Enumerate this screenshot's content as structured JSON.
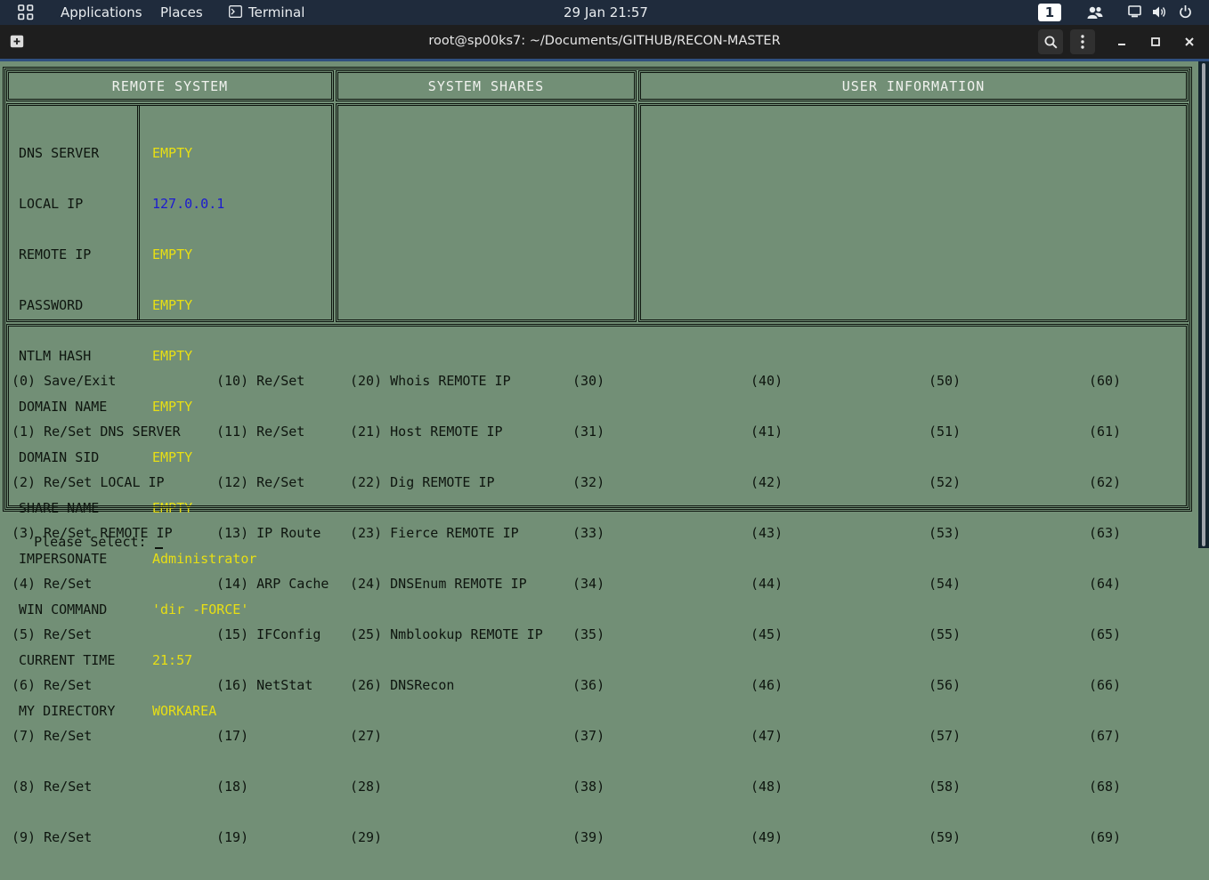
{
  "topbar": {
    "applications": "Applications",
    "places": "Places",
    "terminal": "Terminal",
    "clock": "29 Jan  21:57",
    "workspace": "1"
  },
  "window": {
    "title": "root@sp00ks7: ~/Documents/GITHUB/RECON-MASTER"
  },
  "panels": {
    "remote_system": "REMOTE SYSTEM",
    "system_shares": "SYSTEM SHARES",
    "user_information": "USER INFORMATION"
  },
  "fields": [
    {
      "label": "DNS SERVER",
      "value": "EMPTY"
    },
    {
      "label": "LOCAL IP",
      "value": "127.0.0.1"
    },
    {
      "label": "REMOTE IP",
      "value": "EMPTY"
    },
    {
      "label": "PASSWORD",
      "value": "EMPTY"
    },
    {
      "label": "NTLM HASH",
      "value": "EMPTY"
    },
    {
      "label": "DOMAIN NAME",
      "value": "EMPTY"
    },
    {
      "label": "DOMAIN SID",
      "value": "EMPTY"
    },
    {
      "label": "SHARE NAME",
      "value": "EMPTY"
    },
    {
      "label": "IMPERSONATE",
      "value": "Administrator"
    },
    {
      "label": "WIN COMMAND",
      "value": "'dir -FORCE'"
    },
    {
      "label": "CURRENT TIME",
      "value": "21:57"
    },
    {
      "label": "MY DIRECTORY",
      "value": "WORKAREA"
    }
  ],
  "colors": {
    "value_default": "#e8df14",
    "value_local_ip": "#1d1bd0",
    "background": "#728f76"
  },
  "menu": {
    "col0": [
      "(0) Save/Exit",
      "(1) Re/Set DNS SERVER",
      "(2) Re/Set LOCAL IP",
      "(3) Re/Set REMOTE IP",
      "(4) Re/Set",
      "(5) Re/Set",
      "(6) Re/Set",
      "(7) Re/Set",
      "(8) Re/Set",
      "(9) Re/Set"
    ],
    "col1": [
      "(10) Re/Set",
      "(11) Re/Set",
      "(12) Re/Set",
      "(13) IP Route",
      "(14) ARP Cache",
      "(15) IFConfig",
      "(16) NetStat",
      "(17)",
      "(18)",
      "(19)"
    ],
    "col2": [
      "(20) Whois REMOTE IP",
      "(21) Host REMOTE IP",
      "(22) Dig REMOTE IP",
      "(23) Fierce REMOTE IP",
      "(24) DNSEnum REMOTE IP",
      "(25) Nmblookup REMOTE IP",
      "(26) DNSRecon",
      "(27)",
      "(28)",
      "(29)"
    ],
    "col3": [
      "(30)",
      "(31)",
      "(32)",
      "(33)",
      "(34)",
      "(35)",
      "(36)",
      "(37)",
      "(38)",
      "(39)"
    ],
    "col4": [
      "(40)",
      "(41)",
      "(42)",
      "(43)",
      "(44)",
      "(45)",
      "(46)",
      "(47)",
      "(48)",
      "(49)"
    ],
    "col5": [
      "(50)",
      "(51)",
      "(52)",
      "(53)",
      "(54)",
      "(55)",
      "(56)",
      "(57)",
      "(58)",
      "(59)"
    ],
    "col6": [
      "(60)",
      "(61)",
      "(62)",
      "(63)",
      "(64)",
      "(65)",
      "(66)",
      "(67)",
      "(68)",
      "(69)"
    ]
  },
  "prompt": "Please Select: "
}
